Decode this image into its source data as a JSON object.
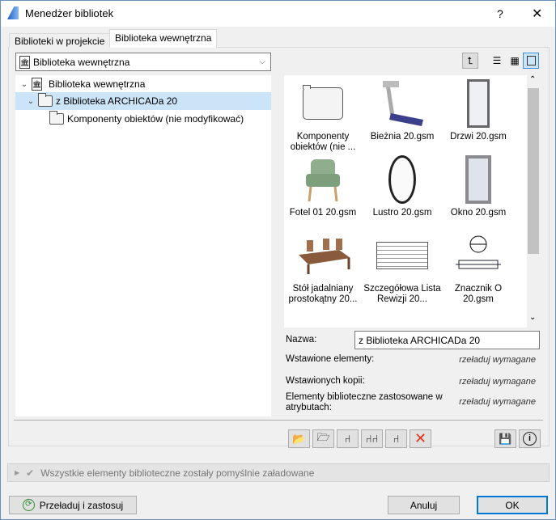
{
  "window": {
    "title": "Menedżer bibliotek",
    "help": "?",
    "close": "✕"
  },
  "tabs": [
    {
      "label": "Biblioteki w projekcie"
    },
    {
      "label": "Biblioteka wewnętrzna"
    }
  ],
  "dropdown": {
    "value": "Biblioteka wewnętrzna"
  },
  "tree": [
    {
      "label": "Biblioteka wewnętrzna"
    },
    {
      "label": "z Biblioteka ARCHICADa 20"
    },
    {
      "label": "Komponenty obiektów (nie modyfikować)"
    }
  ],
  "grid": {
    "items": [
      {
        "label": "Komponenty obiektów (nie ...",
        "icon": "folder-icon"
      },
      {
        "label": "Bieżnia 20.gsm",
        "icon": "treadmill-icon"
      },
      {
        "label": "Drzwi 20.gsm",
        "icon": "door-icon"
      },
      {
        "label": "Fotel 01 20.gsm",
        "icon": "armchair-icon"
      },
      {
        "label": "Lustro 20.gsm",
        "icon": "mirror-icon"
      },
      {
        "label": "Okno 20.gsm",
        "icon": "window-icon"
      },
      {
        "label": "Stół jadalniany prostokątny 20...",
        "icon": "dining-table-icon"
      },
      {
        "label": "Szczegółowa Lista Rewizji 20...",
        "icon": "revision-list-icon"
      },
      {
        "label": "Znacznik O 20.gsm",
        "icon": "marker-icon"
      }
    ]
  },
  "info": {
    "name_label": "Nazwa:",
    "name_value": "z Biblioteka ARCHICADa 20",
    "placed_label": "Wstawione elementy:",
    "placed_value": "rzeładuj wymagane",
    "copies_label": "Wstawionych kopii:",
    "copies_value": "rzeładuj wymagane",
    "attr_label": "Elementy biblioteczne zastosowane w atrybutach:",
    "attr_value": "rzeładuj wymagane"
  },
  "status": {
    "text": "Wszystkie elementy biblioteczne zostały pomyślnie załadowane"
  },
  "buttons": {
    "reload": "Przeładuj i zastosuj",
    "cancel": "Anuluj",
    "ok": "OK"
  }
}
